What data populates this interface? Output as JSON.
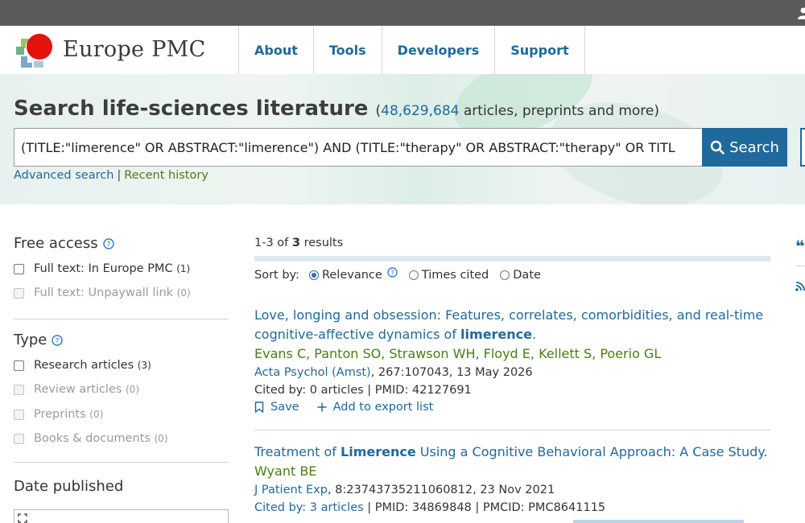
{
  "header": {
    "brand": "Europe PMC",
    "nav": [
      "About",
      "Tools",
      "Developers",
      "Support"
    ]
  },
  "hero": {
    "title": "Search life-sciences literature",
    "count": "48,629,684",
    "count_suffix": " articles, preprints and more)",
    "count_prefix": "(",
    "query": "(TITLE:\"limerence\" OR ABSTRACT:\"limerence\") AND (TITLE:\"therapy\" OR ABSTRACT:\"therapy\" OR TITL",
    "search_label": "Search",
    "advanced_label": "Advanced search",
    "separator": "|",
    "history_label": "Recent history"
  },
  "sidebar": {
    "free_access_title": "Free access",
    "free_access_options": [
      {
        "label": "Full text: In Europe PMC",
        "count": "(1)",
        "disabled": false
      },
      {
        "label": "Full text: Unpaywall link",
        "count": "(0)",
        "disabled": true
      }
    ],
    "type_title": "Type",
    "type_options": [
      {
        "label": "Research articles",
        "count": "(3)",
        "disabled": false
      },
      {
        "label": "Review articles",
        "count": "(0)",
        "disabled": true
      },
      {
        "label": "Preprints",
        "count": "(0)",
        "disabled": true
      },
      {
        "label": "Books & documents",
        "count": "(0)",
        "disabled": true
      }
    ],
    "date_title": "Date published"
  },
  "results": {
    "range": "1-3 of ",
    "total": "3",
    "suffix": " results",
    "sort_label": "Sort by:",
    "sort_options": [
      "Relevance",
      "Times cited",
      "Date"
    ],
    "sort_selected": "Relevance",
    "items": [
      {
        "title_pre": "Love, longing and obsession: Features, correlates, comorbidities, and real-time cognitive-affective dynamics of ",
        "title_bold": "limerence",
        "title_post": ".",
        "authors": "Evans C, Panton SO, Strawson WH, Floyd E, Kellett S, Poerio GL",
        "journal": "Acta Psychol (Amst)",
        "journal_rest": ", 267:107043, 13 May 2026",
        "cited": "Cited by: 0 articles",
        "meta_rest": " | PMID: 42127691",
        "save_label": "Save",
        "export_label": "Add to export list"
      },
      {
        "title_pre": "Treatment of ",
        "title_bold": "Limerence",
        "title_post": " Using a Cognitive Behavioral Approach: A Case Study.",
        "authors": "Wyant BE",
        "journal": "J Patient Exp",
        "journal_rest": ", 8:23743735211060812, 23 Nov 2021",
        "cited": "Cited by: 3 articles",
        "meta_rest": " | PMID: 34869848 | PMCID: PMC8641115"
      }
    ]
  },
  "colors": {
    "accent": "#20699c",
    "author_green": "#4a7d14",
    "topbar": "#5a5a5a",
    "logo_red": "#e3120b"
  },
  "icons": {
    "user": "user-icon",
    "search": "search-icon",
    "help": "help-icon",
    "bookmark": "bookmark-icon",
    "plus": "plus-icon",
    "quote": "quote-icon",
    "rss": "rss-icon",
    "expand": "expand-icon"
  }
}
